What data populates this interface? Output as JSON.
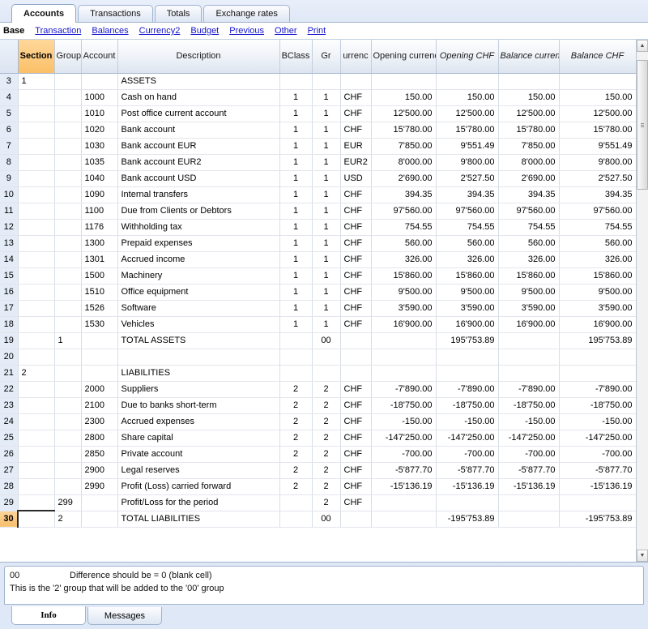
{
  "window": {
    "tabs": [
      {
        "label": "Accounts",
        "active": true
      },
      {
        "label": "Transactions",
        "active": false
      },
      {
        "label": "Totals",
        "active": false
      },
      {
        "label": "Exchange rates",
        "active": false
      }
    ]
  },
  "viewbar": {
    "base_label": "Base",
    "links": [
      "Transaction",
      "Balances",
      "Currency2",
      "Budget",
      "Previous",
      "Other",
      "Print"
    ]
  },
  "grid": {
    "selected_column": "Section",
    "selected_row": "30",
    "columns": [
      {
        "label": "Section",
        "align": "left",
        "italic": false,
        "selected": true
      },
      {
        "label": "Group",
        "align": "left",
        "italic": false,
        "selected": false
      },
      {
        "label": "Account",
        "align": "left",
        "italic": false,
        "selected": false
      },
      {
        "label": "Description",
        "align": "left",
        "italic": false,
        "selected": false
      },
      {
        "label": "BClass",
        "align": "center",
        "italic": false,
        "selected": false
      },
      {
        "label": "Gr",
        "align": "center",
        "italic": false,
        "selected": false
      },
      {
        "label": "urrenc",
        "align": "left",
        "italic": false,
        "selected": false
      },
      {
        "label": "Opening currency",
        "align": "right",
        "italic": false,
        "selected": false
      },
      {
        "label": "Opening CHF",
        "align": "right",
        "italic": true,
        "selected": false
      },
      {
        "label": "Balance currency",
        "align": "right",
        "italic": true,
        "selected": false
      },
      {
        "label": "Balance CHF",
        "align": "right",
        "italic": true,
        "selected": false
      }
    ],
    "rows": [
      {
        "num": "3",
        "section": "1",
        "group": "",
        "account": "",
        "description": "ASSETS",
        "bclass": "",
        "gr": "",
        "currency": "",
        "opening_cur": "",
        "opening_chf": "",
        "balance_cur": "",
        "balance_chf": "",
        "style": "section"
      },
      {
        "num": "4",
        "section": "",
        "group": "",
        "account": "1000",
        "description": "Cash on hand",
        "bclass": "1",
        "gr": "1",
        "currency": "CHF",
        "opening_cur": "150.00",
        "opening_chf": "150.00",
        "balance_cur": "150.00",
        "balance_chf": "150.00",
        "style": "normal"
      },
      {
        "num": "5",
        "section": "",
        "group": "",
        "account": "1010",
        "description": "Post office current account",
        "bclass": "1",
        "gr": "1",
        "currency": "CHF",
        "opening_cur": "12'500.00",
        "opening_chf": "12'500.00",
        "balance_cur": "12'500.00",
        "balance_chf": "12'500.00",
        "style": "normal"
      },
      {
        "num": "6",
        "section": "",
        "group": "",
        "account": "1020",
        "description": "Bank account",
        "bclass": "1",
        "gr": "1",
        "currency": "CHF",
        "opening_cur": "15'780.00",
        "opening_chf": "15'780.00",
        "balance_cur": "15'780.00",
        "balance_chf": "15'780.00",
        "style": "normal"
      },
      {
        "num": "7",
        "section": "",
        "group": "",
        "account": "1030",
        "description": "Bank account EUR",
        "bclass": "1",
        "gr": "1",
        "currency": "EUR",
        "opening_cur": "7'850.00",
        "opening_chf": "9'551.49",
        "balance_cur": "7'850.00",
        "balance_chf": "9'551.49",
        "style": "normal"
      },
      {
        "num": "8",
        "section": "",
        "group": "",
        "account": "1035",
        "description": "Bank account EUR2",
        "bclass": "1",
        "gr": "1",
        "currency": "EUR2",
        "opening_cur": "8'000.00",
        "opening_chf": "9'800.00",
        "balance_cur": "8'000.00",
        "balance_chf": "9'800.00",
        "style": "normal"
      },
      {
        "num": "9",
        "section": "",
        "group": "",
        "account": "1040",
        "description": "Bank account USD",
        "bclass": "1",
        "gr": "1",
        "currency": "USD",
        "opening_cur": "2'690.00",
        "opening_chf": "2'527.50",
        "balance_cur": "2'690.00",
        "balance_chf": "2'527.50",
        "style": "normal"
      },
      {
        "num": "10",
        "section": "",
        "group": "",
        "account": "1090",
        "description": "Internal transfers",
        "bclass": "1",
        "gr": "1",
        "currency": "CHF",
        "opening_cur": "394.35",
        "opening_chf": "394.35",
        "balance_cur": "394.35",
        "balance_chf": "394.35",
        "style": "normal"
      },
      {
        "num": "11",
        "section": "",
        "group": "",
        "account": "1100",
        "description": "Due from Clients or Debtors",
        "bclass": "1",
        "gr": "1",
        "currency": "CHF",
        "opening_cur": "97'560.00",
        "opening_chf": "97'560.00",
        "balance_cur": "97'560.00",
        "balance_chf": "97'560.00",
        "style": "normal"
      },
      {
        "num": "12",
        "section": "",
        "group": "",
        "account": "1176",
        "description": "Withholding tax",
        "bclass": "1",
        "gr": "1",
        "currency": "CHF",
        "opening_cur": "754.55",
        "opening_chf": "754.55",
        "balance_cur": "754.55",
        "balance_chf": "754.55",
        "style": "normal"
      },
      {
        "num": "13",
        "section": "",
        "group": "",
        "account": "1300",
        "description": "Prepaid expenses",
        "bclass": "1",
        "gr": "1",
        "currency": "CHF",
        "opening_cur": "560.00",
        "opening_chf": "560.00",
        "balance_cur": "560.00",
        "balance_chf": "560.00",
        "style": "normal"
      },
      {
        "num": "14",
        "section": "",
        "group": "",
        "account": "1301",
        "description": "Accrued income",
        "bclass": "1",
        "gr": "1",
        "currency": "CHF",
        "opening_cur": "326.00",
        "opening_chf": "326.00",
        "balance_cur": "326.00",
        "balance_chf": "326.00",
        "style": "normal"
      },
      {
        "num": "15",
        "section": "",
        "group": "",
        "account": "1500",
        "description": "Machinery",
        "bclass": "1",
        "gr": "1",
        "currency": "CHF",
        "opening_cur": "15'860.00",
        "opening_chf": "15'860.00",
        "balance_cur": "15'860.00",
        "balance_chf": "15'860.00",
        "style": "normal"
      },
      {
        "num": "16",
        "section": "",
        "group": "",
        "account": "1510",
        "description": "Office equipment",
        "bclass": "1",
        "gr": "1",
        "currency": "CHF",
        "opening_cur": "9'500.00",
        "opening_chf": "9'500.00",
        "balance_cur": "9'500.00",
        "balance_chf": "9'500.00",
        "style": "normal"
      },
      {
        "num": "17",
        "section": "",
        "group": "",
        "account": "1526",
        "description": "Software",
        "bclass": "1",
        "gr": "1",
        "currency": "CHF",
        "opening_cur": "3'590.00",
        "opening_chf": "3'590.00",
        "balance_cur": "3'590.00",
        "balance_chf": "3'590.00",
        "style": "normal"
      },
      {
        "num": "18",
        "section": "",
        "group": "",
        "account": "1530",
        "description": "Vehicles",
        "bclass": "1",
        "gr": "1",
        "currency": "CHF",
        "opening_cur": "16'900.00",
        "opening_chf": "16'900.00",
        "balance_cur": "16'900.00",
        "balance_chf": "16'900.00",
        "style": "normal"
      },
      {
        "num": "19",
        "section": "",
        "group": "1",
        "account": "",
        "description": "TOTAL ASSETS",
        "bclass": "",
        "gr": "00",
        "currency": "",
        "opening_cur": "",
        "opening_chf": "195'753.89",
        "balance_cur": "",
        "balance_chf": "195'753.89",
        "style": "total"
      },
      {
        "num": "20",
        "section": "",
        "group": "",
        "account": "",
        "description": "",
        "bclass": "",
        "gr": "",
        "currency": "",
        "opening_cur": "",
        "opening_chf": "",
        "balance_cur": "",
        "balance_chf": "",
        "style": "empty"
      },
      {
        "num": "21",
        "section": "2",
        "group": "",
        "account": "",
        "description": "LIABILITIES",
        "bclass": "",
        "gr": "",
        "currency": "",
        "opening_cur": "",
        "opening_chf": "",
        "balance_cur": "",
        "balance_chf": "",
        "style": "section"
      },
      {
        "num": "22",
        "section": "",
        "group": "",
        "account": "2000",
        "description": "Suppliers",
        "bclass": "2",
        "gr": "2",
        "currency": "CHF",
        "opening_cur": "-7'890.00",
        "opening_chf": "-7'890.00",
        "balance_cur": "-7'890.00",
        "balance_chf": "-7'890.00",
        "style": "negative"
      },
      {
        "num": "23",
        "section": "",
        "group": "",
        "account": "2100",
        "description": "Due to banks short-term",
        "bclass": "2",
        "gr": "2",
        "currency": "CHF",
        "opening_cur": "-18'750.00",
        "opening_chf": "-18'750.00",
        "balance_cur": "-18'750.00",
        "balance_chf": "-18'750.00",
        "style": "negative"
      },
      {
        "num": "24",
        "section": "",
        "group": "",
        "account": "2300",
        "description": "Accrued expenses",
        "bclass": "2",
        "gr": "2",
        "currency": "CHF",
        "opening_cur": "-150.00",
        "opening_chf": "-150.00",
        "balance_cur": "-150.00",
        "balance_chf": "-150.00",
        "style": "negative"
      },
      {
        "num": "25",
        "section": "",
        "group": "",
        "account": "2800",
        "description": "Share capital",
        "bclass": "2",
        "gr": "2",
        "currency": "CHF",
        "opening_cur": "-147'250.00",
        "opening_chf": "-147'250.00",
        "balance_cur": "-147'250.00",
        "balance_chf": "-147'250.00",
        "style": "negative"
      },
      {
        "num": "26",
        "section": "",
        "group": "",
        "account": "2850",
        "description": "Private account",
        "bclass": "2",
        "gr": "2",
        "currency": "CHF",
        "opening_cur": "-700.00",
        "opening_chf": "-700.00",
        "balance_cur": "-700.00",
        "balance_chf": "-700.00",
        "style": "negative"
      },
      {
        "num": "27",
        "section": "",
        "group": "",
        "account": "2900",
        "description": "Legal reserves",
        "bclass": "2",
        "gr": "2",
        "currency": "CHF",
        "opening_cur": "-5'877.70",
        "opening_chf": "-5'877.70",
        "balance_cur": "-5'877.70",
        "balance_chf": "-5'877.70",
        "style": "negative"
      },
      {
        "num": "28",
        "section": "",
        "group": "",
        "account": "2990",
        "description": "Profit (Loss) carried forward",
        "bclass": "2",
        "gr": "2",
        "currency": "CHF",
        "opening_cur": "-15'136.19",
        "opening_chf": "-15'136.19",
        "balance_cur": "-15'136.19",
        "balance_chf": "-15'136.19",
        "style": "negative"
      },
      {
        "num": "29",
        "section": "",
        "group": "299",
        "account": "",
        "description": "Profit/Loss for the period",
        "bclass": "",
        "gr": "2",
        "currency": "CHF",
        "opening_cur": "",
        "opening_chf": "",
        "balance_cur": "",
        "balance_chf": "",
        "style": "normal"
      },
      {
        "num": "30",
        "section": "",
        "group": "2",
        "account": "",
        "description": "TOTAL LIABILITIES",
        "bclass": "",
        "gr": "00",
        "currency": "",
        "opening_cur": "",
        "opening_chf": "-195'753.89",
        "balance_cur": "",
        "balance_chf": "-195'753.89",
        "style": "total-negative"
      }
    ]
  },
  "info": {
    "code": "00",
    "code_text": "Difference should be = 0 (blank cell)",
    "line2": "This is the '2' group that will be added to the '00' group",
    "tabs": [
      {
        "label": "Info",
        "active": true
      },
      {
        "label": "Messages",
        "active": false
      }
    ]
  },
  "scrollbar": {
    "up_arrow": "▲",
    "down_arrow": "▼"
  },
  "colors": {
    "negative": "#ff2a2a",
    "selection": "#fbc068",
    "link": "#1414cc"
  }
}
